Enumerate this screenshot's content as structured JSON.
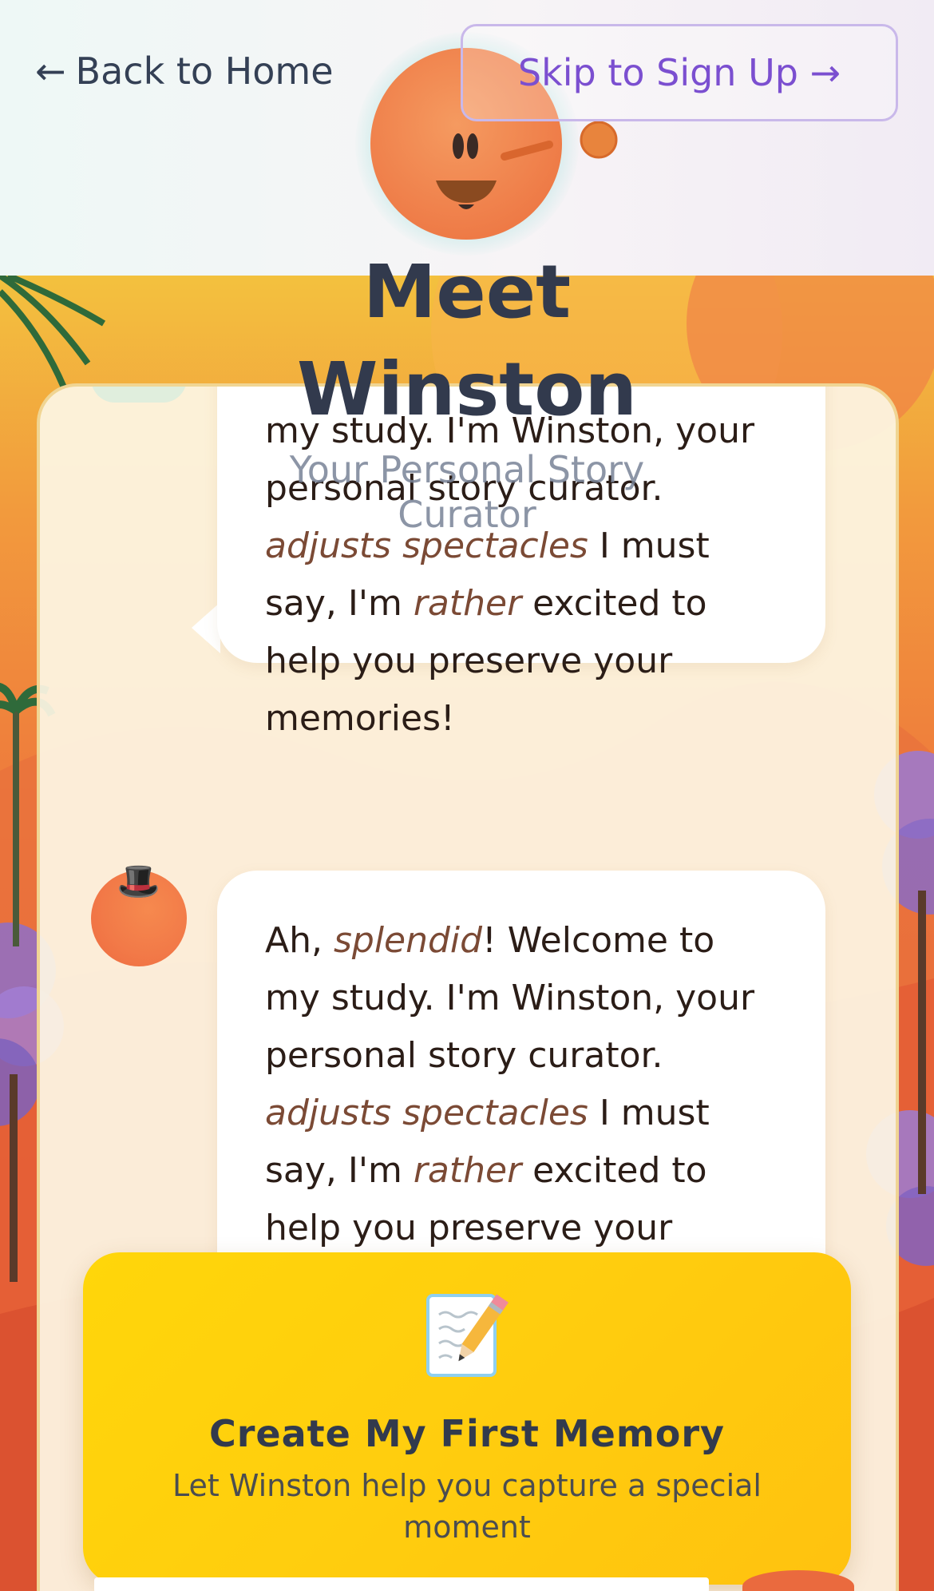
{
  "nav": {
    "back_label": "Back to Home",
    "back_arrow": "←",
    "skip_label": "Skip to Sign Up",
    "skip_arrow": "→"
  },
  "header": {
    "title_line1": "Meet",
    "title_line2": "Winston",
    "subtitle_line1": "Your Personal Story",
    "subtitle_line2": "Curator"
  },
  "chat": {
    "messages": [
      {
        "partial_line1": "my study. I'm Winston, your",
        "partial_line2": "personal story curator.",
        "action": "adjusts spectacles",
        "text_a": " I must say, I'm ",
        "emphasis": "rather",
        "text_b": " excited to help you preserve your memories!"
      },
      {
        "intro": "Ah, ",
        "emphasis1": "splendid",
        "text1": "! Welcome to my study. I'm Winston, your personal story curator. ",
        "action": "adjusts spectacles",
        "text_a": " I must say, I'm ",
        "emphasis2": "rather",
        "text_b": " excited to help you preserve your"
      }
    ],
    "avatar_hat_icon": "🎩"
  },
  "cta": {
    "icon": "memo-pencil-icon",
    "title": "Create My First Memory",
    "subtitle": "Let Winston help you capture a special moment"
  },
  "colors": {
    "accent_purple": "#7b4fd0",
    "cta_yellow": "#ffd60a",
    "mascot_orange": "#f27a48",
    "heading_dark": "#323a4d"
  }
}
